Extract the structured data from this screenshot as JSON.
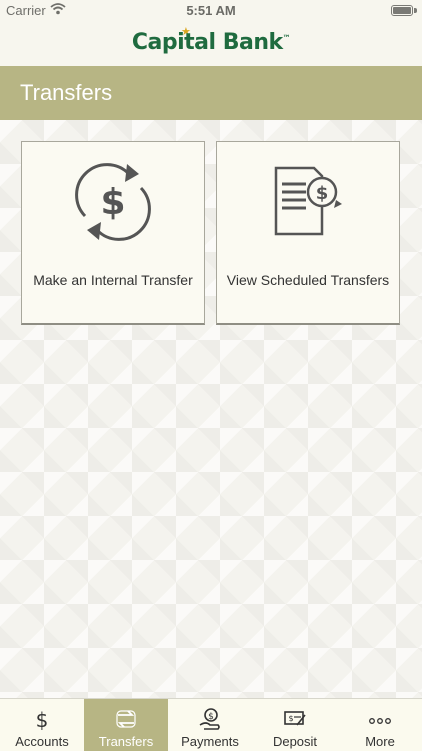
{
  "status": {
    "carrier": "Carrier",
    "time": "5:51 AM"
  },
  "logo": {
    "text": "Capital Bank",
    "tm": "™"
  },
  "header": {
    "title": "Transfers"
  },
  "cards": [
    {
      "label": "Make an Internal Transfer",
      "icon": "dollar-cycle-icon"
    },
    {
      "label": "View Scheduled Transfers",
      "icon": "document-dollar-icon"
    }
  ],
  "tabs": [
    {
      "label": "Accounts",
      "icon": "dollar-icon"
    },
    {
      "label": "Transfers",
      "icon": "transfer-arrows-icon",
      "active": true
    },
    {
      "label": "Payments",
      "icon": "hand-dollar-icon"
    },
    {
      "label": "Deposit",
      "icon": "check-deposit-icon"
    },
    {
      "label": "More",
      "icon": "more-dots-icon"
    }
  ],
  "colors": {
    "brand_green": "#1f6b3f",
    "accent_olive": "#b7b584",
    "star_gold": "#d9a520"
  }
}
